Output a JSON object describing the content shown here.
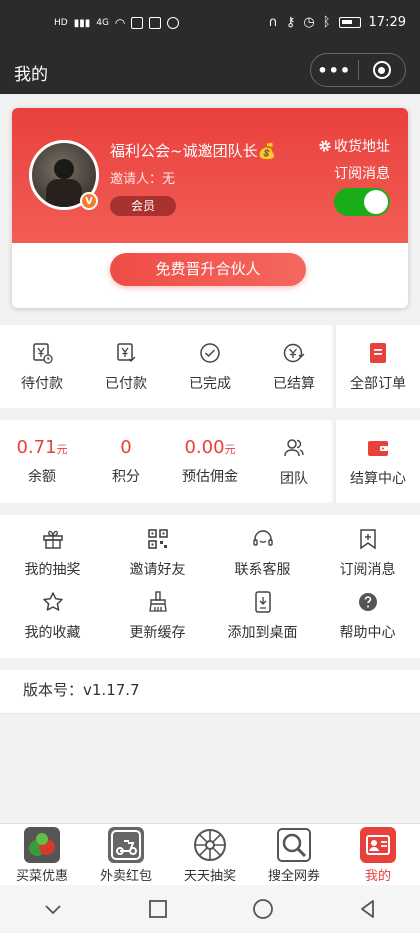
{
  "status_bar": {
    "time": "17:29",
    "network": "4G"
  },
  "nav": {
    "title": "我的",
    "more_label": "•••"
  },
  "profile": {
    "nickname": "福利公会~诚邀团队长💰",
    "inviter": "邀请人：无",
    "member_tag": "会员",
    "badge": "V",
    "address_link": "收货地址",
    "subscribe_label": "订阅消息",
    "subscribe_on": true,
    "upgrade_button": "免费晋升合伙人"
  },
  "orders": [
    {
      "label": "待付款",
      "icon": "yen-clock-icon"
    },
    {
      "label": "已付款",
      "icon": "yen-check-icon"
    },
    {
      "label": "已完成",
      "icon": "check-circle-icon"
    },
    {
      "label": "已结算",
      "icon": "yen-circle-icon"
    },
    {
      "label": "全部订单",
      "icon": "order-list-icon"
    }
  ],
  "assets": [
    {
      "value": "0.71",
      "unit": "元",
      "label": "余额"
    },
    {
      "value": "0",
      "unit": "",
      "label": "积分"
    },
    {
      "value": "0.00",
      "unit": "元",
      "label": "预估佣金"
    },
    {
      "label": "团队",
      "icon": "team-icon"
    },
    {
      "label": "结算中心",
      "icon": "wallet-icon"
    }
  ],
  "tools": [
    {
      "label": "我的抽奖",
      "icon": "gift-icon"
    },
    {
      "label": "邀请好友",
      "icon": "qrcode-icon"
    },
    {
      "label": "联系客服",
      "icon": "headset-icon"
    },
    {
      "label": "订阅消息",
      "icon": "bookmark-plus-icon"
    },
    {
      "label": "我的收藏",
      "icon": "star-icon"
    },
    {
      "label": "更新缓存",
      "icon": "broom-icon"
    },
    {
      "label": "添加到桌面",
      "icon": "phone-download-icon"
    },
    {
      "label": "帮助中心",
      "icon": "help-icon"
    }
  ],
  "version": "版本号：v1.17.7",
  "tabbar": [
    {
      "label": "买菜优惠",
      "icon": "vegetable-icon",
      "active": false
    },
    {
      "label": "外卖红包",
      "icon": "scooter-icon",
      "active": false
    },
    {
      "label": "天天抽奖",
      "icon": "wheel-icon",
      "active": false
    },
    {
      "label": "搜全网券",
      "icon": "search-icon",
      "active": false
    },
    {
      "label": "我的",
      "icon": "profile-card-icon",
      "active": true
    }
  ],
  "colors": {
    "accent": "#e8403b",
    "nav_bg": "#2b2b2b",
    "toggle_on": "#1aad19"
  }
}
